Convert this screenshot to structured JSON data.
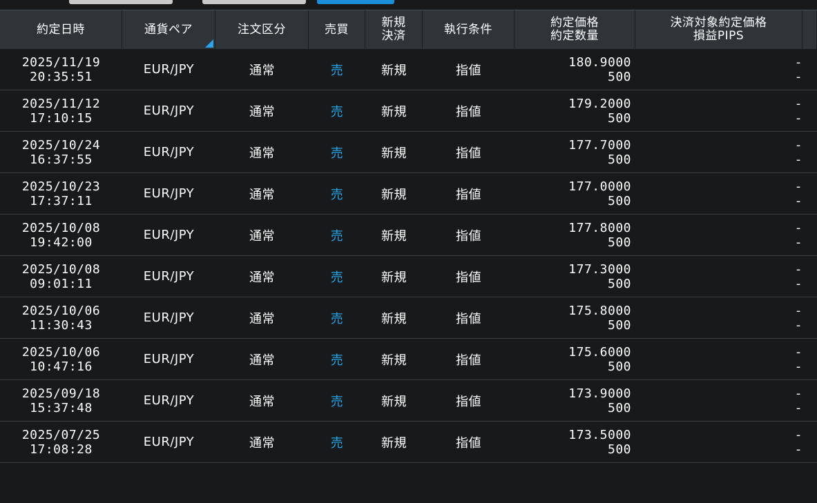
{
  "header": {
    "datetime": "約定日時",
    "pair": "通貨ペア",
    "order_type": "注文区分",
    "side": "売買",
    "new_settle_1": "新規",
    "new_settle_2": "決済",
    "exec_cond": "執行条件",
    "price_qty_1": "約定価格",
    "price_qty_2": "約定数量",
    "settle_pips_1": "決済対象約定価格",
    "settle_pips_2": "損益PIPS"
  },
  "rows": [
    {
      "date": "2025/11/19",
      "time": "20:35:51",
      "pair": "EUR/JPY",
      "order_type": "通常",
      "side": "売",
      "new_settle": "新規",
      "exec": "指値",
      "price": "180.9000",
      "qty": "500",
      "settle_price": "-",
      "pips": "-"
    },
    {
      "date": "2025/11/12",
      "time": "17:10:15",
      "pair": "EUR/JPY",
      "order_type": "通常",
      "side": "売",
      "new_settle": "新規",
      "exec": "指値",
      "price": "179.2000",
      "qty": "500",
      "settle_price": "-",
      "pips": "-"
    },
    {
      "date": "2025/10/24",
      "time": "16:37:55",
      "pair": "EUR/JPY",
      "order_type": "通常",
      "side": "売",
      "new_settle": "新規",
      "exec": "指値",
      "price": "177.7000",
      "qty": "500",
      "settle_price": "-",
      "pips": "-"
    },
    {
      "date": "2025/10/23",
      "time": "17:37:11",
      "pair": "EUR/JPY",
      "order_type": "通常",
      "side": "売",
      "new_settle": "新規",
      "exec": "指値",
      "price": "177.0000",
      "qty": "500",
      "settle_price": "-",
      "pips": "-"
    },
    {
      "date": "2025/10/08",
      "time": "19:42:00",
      "pair": "EUR/JPY",
      "order_type": "通常",
      "side": "売",
      "new_settle": "新規",
      "exec": "指値",
      "price": "177.8000",
      "qty": "500",
      "settle_price": "-",
      "pips": "-"
    },
    {
      "date": "2025/10/08",
      "time": "09:01:11",
      "pair": "EUR/JPY",
      "order_type": "通常",
      "side": "売",
      "new_settle": "新規",
      "exec": "指値",
      "price": "177.3000",
      "qty": "500",
      "settle_price": "-",
      "pips": "-"
    },
    {
      "date": "2025/10/06",
      "time": "11:30:43",
      "pair": "EUR/JPY",
      "order_type": "通常",
      "side": "売",
      "new_settle": "新規",
      "exec": "指値",
      "price": "175.8000",
      "qty": "500",
      "settle_price": "-",
      "pips": "-"
    },
    {
      "date": "2025/10/06",
      "time": "10:47:16",
      "pair": "EUR/JPY",
      "order_type": "通常",
      "side": "売",
      "new_settle": "新規",
      "exec": "指値",
      "price": "175.6000",
      "qty": "500",
      "settle_price": "-",
      "pips": "-"
    },
    {
      "date": "2025/09/18",
      "time": "15:37:48",
      "pair": "EUR/JPY",
      "order_type": "通常",
      "side": "売",
      "new_settle": "新規",
      "exec": "指値",
      "price": "173.9000",
      "qty": "500",
      "settle_price": "-",
      "pips": "-"
    },
    {
      "date": "2025/07/25",
      "time": "17:08:28",
      "pair": "EUR/JPY",
      "order_type": "通常",
      "side": "売",
      "new_settle": "新規",
      "exec": "指値",
      "price": "173.5000",
      "qty": "500",
      "settle_price": "-",
      "pips": "-"
    }
  ],
  "colors": {
    "sell": "#2aa3e8",
    "accent_button": "#1a8fd8"
  }
}
